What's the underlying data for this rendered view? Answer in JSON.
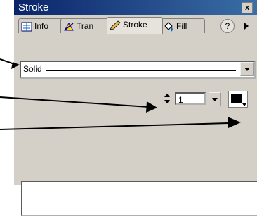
{
  "window": {
    "title": "Stroke",
    "close_glyph": "✕"
  },
  "tabs": [
    {
      "label": "Info",
      "icon": "info-icon"
    },
    {
      "label": "Tran",
      "icon": "transform-icon"
    },
    {
      "label": "Stroke",
      "icon": "pencil-icon"
    },
    {
      "label": "Fill",
      "icon": "paint-bucket-icon"
    }
  ],
  "help_label": "?",
  "stroke": {
    "style": "Solid",
    "size": "1",
    "color": "#000000"
  },
  "colors": {
    "title_bar": "#0a246a",
    "panel": "#d4d0c8"
  }
}
